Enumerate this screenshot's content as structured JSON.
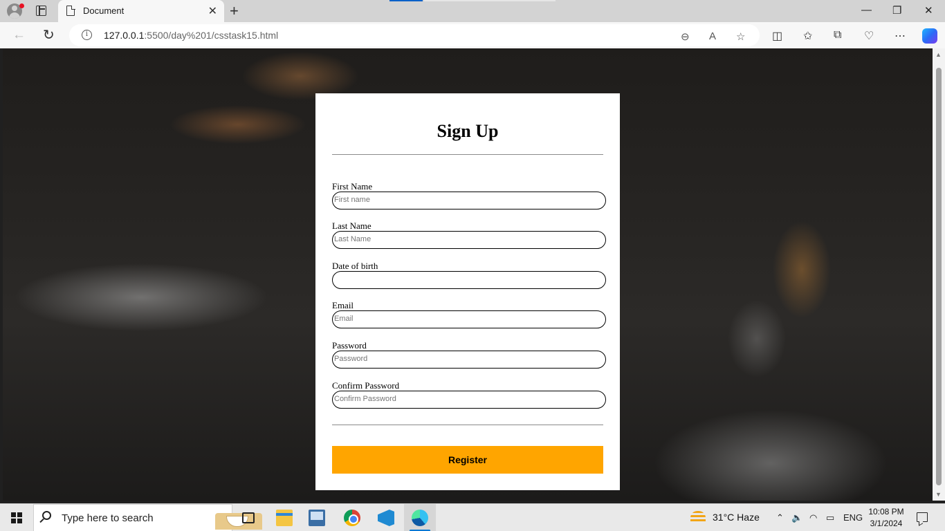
{
  "browser": {
    "tab_title": "Document",
    "tab_close": "✕",
    "new_tab": "+",
    "url_host": "127.0.0.1",
    "url_path": ":5500/day%201/csstask15.html",
    "window_controls": {
      "minimize": "—",
      "restore": "❐",
      "close": "✕"
    },
    "icons": [
      "profile-icon",
      "tab-actions-icon",
      "document-icon",
      "back-icon",
      "reload-icon",
      "site-info-icon",
      "zoom-out-icon",
      "read-aloud-icon",
      "favorite-star-icon",
      "split-screen-icon",
      "favorites-icon",
      "collections-icon",
      "browser-essentials-icon",
      "more-icon",
      "copilot-icon"
    ]
  },
  "form": {
    "title": "Sign Up",
    "fields": [
      {
        "label": "First Name",
        "placeholder": "First name"
      },
      {
        "label": "Last Name",
        "placeholder": "Last Name"
      },
      {
        "label": "Date of birth",
        "placeholder": ""
      },
      {
        "label": "Email",
        "placeholder": "Email"
      },
      {
        "label": "Password",
        "placeholder": "Password"
      },
      {
        "label": "Confirm Password",
        "placeholder": "Confirm Password"
      }
    ],
    "submit_label": "Register",
    "submit_color": "#FFA500"
  },
  "taskbar": {
    "search_placeholder": "Type here to search",
    "weather": "31°C  Haze",
    "language": "ENG",
    "time": "10:08 PM",
    "date": "3/1/2024",
    "apps": [
      "task-view-icon",
      "file-explorer-icon",
      "remote-desktop-icon",
      "chrome-icon",
      "vscode-icon",
      "edge-icon"
    ]
  }
}
